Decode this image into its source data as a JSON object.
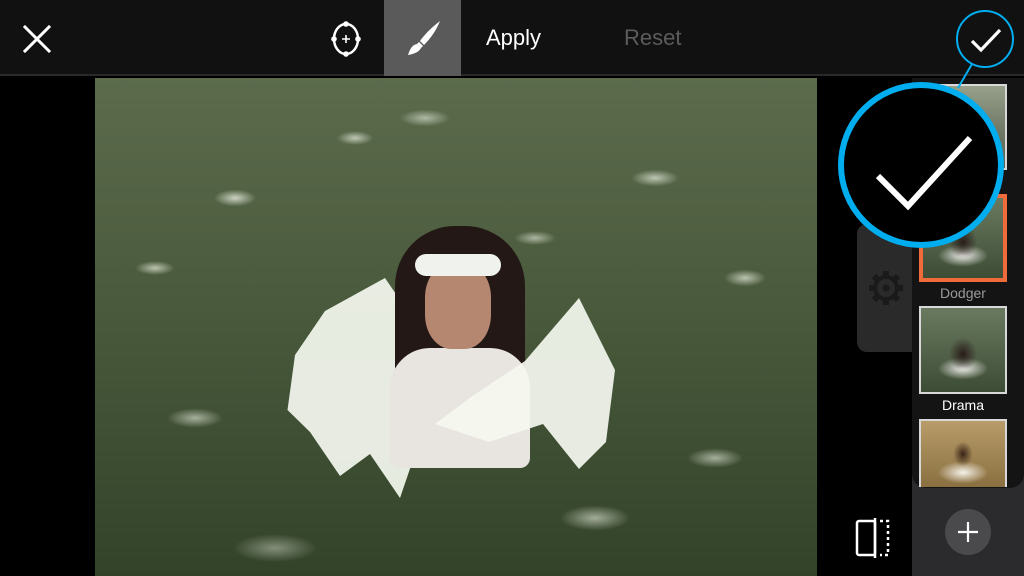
{
  "toolbar": {
    "close_icon": "close-icon",
    "target_icon": "crosshair-target-icon",
    "brush_icon": "paintbrush-icon",
    "brush_active": true,
    "apply_label": "Apply",
    "reset_label": "Reset",
    "confirm_icon": "checkmark-icon"
  },
  "colors": {
    "accent": "#00aeef",
    "selected_border": "#ef6b3a",
    "toolbar_bg": "#111111",
    "active_tool_bg": "#5a5a5a",
    "reset_disabled": "#5c5c5c"
  },
  "canvas": {
    "image_description": "Girl with flower crown and white angel wings sitting in a field of white wildflowers"
  },
  "side_controls": {
    "settings_icon": "gear-icon",
    "compare_icon": "compare-split-icon",
    "add_icon": "plus-icon"
  },
  "effects": [
    {
      "label": "",
      "style": "gray",
      "selected": false
    },
    {
      "label": "Dodger",
      "style": "green",
      "selected": true
    },
    {
      "label": "Drama",
      "style": "green",
      "selected": false
    },
    {
      "label": "",
      "style": "sepia",
      "selected": false
    }
  ],
  "magnifier": {
    "icon": "checkmark-icon",
    "target": "confirm-button"
  }
}
